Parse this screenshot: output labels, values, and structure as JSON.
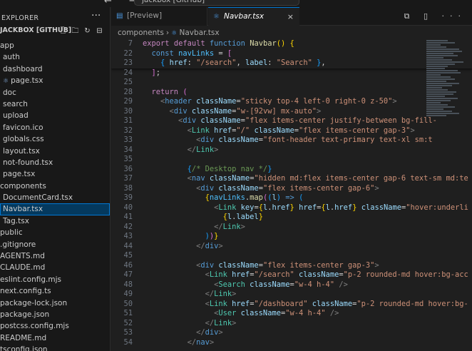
{
  "titlebar": {
    "back_forward": "← →",
    "command_center": "jackbox [GitHub]"
  },
  "sidebar": {
    "title": "EXPLORER",
    "more": "···",
    "project": "JACKBOX [GITHUB]",
    "actions": [
      "new-file",
      "new-folder",
      "refresh",
      "collapse"
    ],
    "items": [
      {
        "label": "app",
        "indent": 0,
        "folder": true
      },
      {
        "label": "auth",
        "indent": 1,
        "folder": true
      },
      {
        "label": "dashboard",
        "indent": 1,
        "folder": true
      },
      {
        "label": "page.tsx",
        "indent": 1,
        "folder": false,
        "icon": "react-icon"
      },
      {
        "label": "doc",
        "indent": 1,
        "folder": true
      },
      {
        "label": "search",
        "indent": 1,
        "folder": true
      },
      {
        "label": "upload",
        "indent": 1,
        "folder": true
      },
      {
        "label": "favicon.ico",
        "indent": 1,
        "folder": false
      },
      {
        "label": "globals.css",
        "indent": 1,
        "folder": false
      },
      {
        "label": "layout.tsx",
        "indent": 1,
        "folder": false
      },
      {
        "label": "not-found.tsx",
        "indent": 1,
        "folder": false
      },
      {
        "label": "page.tsx",
        "indent": 1,
        "folder": false
      },
      {
        "label": "components",
        "indent": 0,
        "folder": true
      },
      {
        "label": "DocumentCard.tsx",
        "indent": 1,
        "folder": false
      },
      {
        "label": "Navbar.tsx",
        "indent": 1,
        "folder": false,
        "selected": true
      },
      {
        "label": "Tag.tsx",
        "indent": 1,
        "folder": false
      },
      {
        "label": "public",
        "indent": 0,
        "folder": true
      },
      {
        "label": ".gitignore",
        "indent": 0,
        "folder": false
      },
      {
        "label": "AGENTS.md",
        "indent": 0,
        "folder": false
      },
      {
        "label": "CLAUDE.md",
        "indent": 0,
        "folder": false
      },
      {
        "label": "eslint.config.mjs",
        "indent": 0,
        "folder": false
      },
      {
        "label": "next.config.ts",
        "indent": 0,
        "folder": false
      },
      {
        "label": "package-lock.json",
        "indent": 0,
        "folder": false
      },
      {
        "label": "package.json",
        "indent": 0,
        "folder": false
      },
      {
        "label": "postcss.config.mjs",
        "indent": 0,
        "folder": false
      },
      {
        "label": "README.md",
        "indent": 0,
        "folder": false
      },
      {
        "label": "tsconfig.json",
        "indent": 0,
        "folder": false
      }
    ]
  },
  "tabs": [
    {
      "label": "[Preview] README.md",
      "active": false
    },
    {
      "label": "Navbar.tsx",
      "active": true,
      "close": "×"
    }
  ],
  "tab_actions": "⧉ ▯ ···",
  "breadcrumbs": [
    "components",
    "Navbar.tsx"
  ],
  "code": {
    "sticky": [
      {
        "n": "7",
        "html": "<span class=\"kc\">export</span> <span class=\"kc\">default</span> <span class=\"kw\">function</span> <span class=\"fn\">Navbar</span><span class=\"br1\">()</span> <span class=\"br1\">{</span>"
      },
      {
        "n": "22",
        "html": "  <span class=\"kw\">const</span> <span class=\"cn\">navLinks</span> <span class=\"pu\">=</span> <span class=\"br2\">[</span>"
      },
      {
        "n": "23",
        "html": "    <span class=\"br3\">{</span> <span class=\"vr\">href</span><span class=\"pu\">:</span> <span class=\"st\">\"/search\"</span><span class=\"pu\">,</span> <span class=\"vr\">label</span><span class=\"pu\">:</span> <span class=\"st\">\"Search\"</span> <span class=\"br3\">}</span><span class=\"pu\">,</span>"
      }
    ],
    "lines": [
      {
        "n": "24",
        "html": "  <span class=\"br2\">]</span><span class=\"pu\">;</span>"
      },
      {
        "n": "25",
        "html": ""
      },
      {
        "n": "28",
        "html": "  <span class=\"kc\">return</span> <span class=\"br2\">(</span>"
      },
      {
        "n": "29",
        "html": "    <span class=\"tgp\">&lt;</span><span class=\"kw\">header</span> <span class=\"at\">className</span><span class=\"pu\">=</span><span class=\"st\">\"sticky top-4 left-0 right-0 z-50\"</span><span class=\"tgp\">&gt;</span>"
      },
      {
        "n": "30",
        "html": "      <span class=\"tgp\">&lt;</span><span class=\"kw\">div</span> <span class=\"at\">className</span><span class=\"pu\">=</span><span class=\"st\">\"w-[92vw] mx-auto\"</span><span class=\"tgp\">&gt;</span>"
      },
      {
        "n": "31",
        "html": "        <span class=\"tgp\">&lt;</span><span class=\"kw\">div</span> <span class=\"at\">className</span><span class=\"pu\">=</span><span class=\"st\">\"flex items-center justify-between bg-fill-</span>"
      },
      {
        "n": "32",
        "html": "          <span class=\"tgp\">&lt;</span><span class=\"tg\">Link</span> <span class=\"at\">href</span><span class=\"pu\">=</span><span class=\"st\">\"/\"</span> <span class=\"at\">className</span><span class=\"pu\">=</span><span class=\"st\">\"flex items-center gap-3\"</span><span class=\"tgp\">&gt;</span>"
      },
      {
        "n": "33",
        "html": "            <span class=\"tgp\">&lt;</span><span class=\"kw\">div</span> <span class=\"at\">className</span><span class=\"pu\">=</span><span class=\"st\">\"font-header text-primary text-xl sm:t</span>"
      },
      {
        "n": "34",
        "html": "          <span class=\"tgp\">&lt;/</span><span class=\"tg\">Link</span><span class=\"tgp\">&gt;</span>"
      },
      {
        "n": "35",
        "html": ""
      },
      {
        "n": "36",
        "html": "          <span class=\"br3\">{</span><span class=\"cm\">/* Desktop nav */</span><span class=\"br3\">}</span>"
      },
      {
        "n": "37",
        "html": "          <span class=\"tgp\">&lt;</span><span class=\"kw\">nav</span> <span class=\"at\">className</span><span class=\"pu\">=</span><span class=\"st\">\"hidden md:flex items-center gap-6 text-sm md:te</span>"
      },
      {
        "n": "38",
        "html": "            <span class=\"tgp\">&lt;</span><span class=\"kw\">div</span> <span class=\"at\">className</span><span class=\"pu\">=</span><span class=\"st\">\"flex items-center gap-6\"</span><span class=\"tgp\">&gt;</span>"
      },
      {
        "n": "39",
        "html": "              <span class=\"br1\">{</span><span class=\"cn\">navLinks</span><span class=\"pu\">.</span><span class=\"fn\">map</span><span class=\"br2\">(</span><span class=\"br3\">(</span><span class=\"vr\">l</span><span class=\"br3\">)</span> <span class=\"kw\">=&gt;</span> <span class=\"br3\">(</span>"
      },
      {
        "n": "40",
        "html": "                <span class=\"tgp\">&lt;</span><span class=\"tg\">Link</span> <span class=\"at\">key</span><span class=\"pu\">=</span><span class=\"br1\">{</span><span class=\"vr\">l</span><span class=\"pu\">.</span><span class=\"vr\">href</span><span class=\"br1\">}</span> <span class=\"at\">href</span><span class=\"pu\">=</span><span class=\"br1\">{</span><span class=\"vr\">l</span><span class=\"pu\">.</span><span class=\"vr\">href</span><span class=\"br1\">}</span> <span class=\"at\">className</span><span class=\"pu\">=</span><span class=\"st\">\"hover:underli</span>"
      },
      {
        "n": "41",
        "html": "                  <span class=\"br1\">{</span><span class=\"vr\">l</span><span class=\"pu\">.</span><span class=\"vr\">label</span><span class=\"br1\">}</span>"
      },
      {
        "n": "42",
        "html": "                <span class=\"tgp\">&lt;/</span><span class=\"tg\">Link</span><span class=\"tgp\">&gt;</span>"
      },
      {
        "n": "43",
        "html": "              <span class=\"br3\">)</span><span class=\"br2\">)</span><span class=\"br1\">}</span>"
      },
      {
        "n": "44",
        "html": "            <span class=\"tgp\">&lt;/</span><span class=\"kw\">div</span><span class=\"tgp\">&gt;</span>"
      },
      {
        "n": "45",
        "html": ""
      },
      {
        "n": "46",
        "html": "            <span class=\"tgp\">&lt;</span><span class=\"kw\">div</span> <span class=\"at\">className</span><span class=\"pu\">=</span><span class=\"st\">\"flex items-center gap-3\"</span><span class=\"tgp\">&gt;</span>"
      },
      {
        "n": "47",
        "html": "              <span class=\"tgp\">&lt;</span><span class=\"tg\">Link</span> <span class=\"at\">href</span><span class=\"pu\">=</span><span class=\"st\">\"/search\"</span> <span class=\"at\">className</span><span class=\"pu\">=</span><span class=\"st\">\"p-2 rounded-md hover:bg-acc</span>"
      },
      {
        "n": "48",
        "html": "                <span class=\"tgp\">&lt;</span><span class=\"tg\">Search</span> <span class=\"at\">className</span><span class=\"pu\">=</span><span class=\"st\">\"w-4 h-4\"</span> <span class=\"tgp\">/&gt;</span>"
      },
      {
        "n": "49",
        "html": "              <span class=\"tgp\">&lt;/</span><span class=\"tg\">Link</span><span class=\"tgp\">&gt;</span>"
      },
      {
        "n": "50",
        "html": "              <span class=\"tgp\">&lt;</span><span class=\"tg\">Link</span> <span class=\"at\">href</span><span class=\"pu\">=</span><span class=\"st\">\"/dashboard\"</span> <span class=\"at\">className</span><span class=\"pu\">=</span><span class=\"st\">\"p-2 rounded-md hover:bg-</span>"
      },
      {
        "n": "51",
        "html": "                <span class=\"tgp\">&lt;</span><span class=\"tg\">User</span> <span class=\"at\">className</span><span class=\"pu\">=</span><span class=\"st\">\"w-4 h-4\"</span> <span class=\"tgp\">/&gt;</span>"
      },
      {
        "n": "52",
        "html": "              <span class=\"tgp\">&lt;/</span><span class=\"tg\">Link</span><span class=\"tgp\">&gt;</span>"
      },
      {
        "n": "53",
        "html": "            <span class=\"tgp\">&lt;/</span><span class=\"kw\">div</span><span class=\"tgp\">&gt;</span>"
      },
      {
        "n": "54",
        "html": "          <span class=\"tgp\">&lt;/</span><span class=\"kw\">nav</span><span class=\"tgp\">&gt;</span>"
      }
    ]
  },
  "colors": {
    "accent": "#0078d4",
    "selection": "#04395e",
    "keyword": "#569cd6",
    "string": "#ce9178",
    "component": "#4ec9b0"
  }
}
